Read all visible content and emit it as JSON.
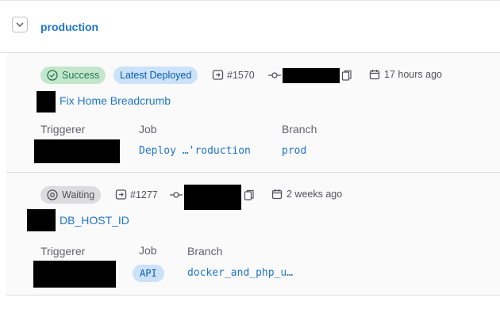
{
  "environment": {
    "name": "production"
  },
  "deployments": [
    {
      "status": "Success",
      "latest_badge": "Latest Deployed",
      "iid": "#1570",
      "time": "17 hours ago",
      "commit_title": "Fix Home Breadcrumb",
      "labels": {
        "triggerer": "Triggerer",
        "job": "Job",
        "branch": "Branch"
      },
      "job": "Deploy …'roduction",
      "branch": "prod"
    },
    {
      "status": "Waiting",
      "iid": "#1277",
      "time": "2 weeks ago",
      "commit_title": "DB_HOST_ID",
      "labels": {
        "triggerer": "Triggerer",
        "job": "Job",
        "branch": "Branch"
      },
      "job": "API",
      "branch": "docker_and_php_u…"
    }
  ],
  "colors": {
    "link": "#1f75cb",
    "success_bg": "#c3e6cd",
    "success_fg": "#217645",
    "info_bg": "#cbe2f9",
    "neutral_bg": "#dcdcde"
  }
}
